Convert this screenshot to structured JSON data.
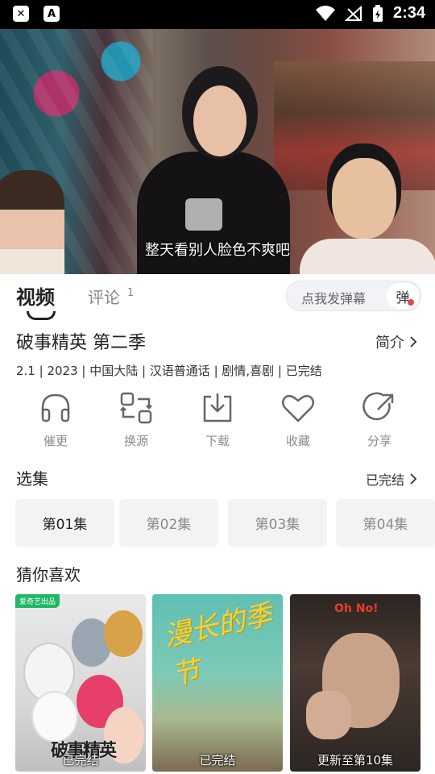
{
  "status_bar": {
    "time": "2:34"
  },
  "video": {
    "subtitle": "整天看别人脸色不爽吧"
  },
  "tabs": {
    "video": "视频",
    "comments": "评论",
    "comments_count": "1"
  },
  "danmu": {
    "placeholder": "点我发弹幕",
    "button": "弹"
  },
  "show": {
    "title": "破事精英 第二季",
    "intro": "简介",
    "meta": "2.1 | 2023 | 中国大陆 | 汉语普通话 | 剧情,喜剧 | 已完结"
  },
  "actions": [
    {
      "label": "催更",
      "icon": "headphones-icon"
    },
    {
      "label": "换源",
      "icon": "switch-source-icon"
    },
    {
      "label": "下载",
      "icon": "download-icon"
    },
    {
      "label": "收藏",
      "icon": "heart-icon"
    },
    {
      "label": "分享",
      "icon": "share-icon"
    }
  ],
  "episodes": {
    "title": "选集",
    "status": "已完结",
    "items": [
      "第01集",
      "第02集",
      "第03集",
      "第04集"
    ]
  },
  "recommend": {
    "title": "猜你喜欢",
    "items": [
      {
        "caption": "已完结",
        "badge": "爱奇艺出品",
        "poster_text": "破事精英"
      },
      {
        "caption": "已完结",
        "poster_text": "漫长的季节"
      },
      {
        "caption": "更新至第10集",
        "poster_text": "Oh No!"
      }
    ]
  }
}
